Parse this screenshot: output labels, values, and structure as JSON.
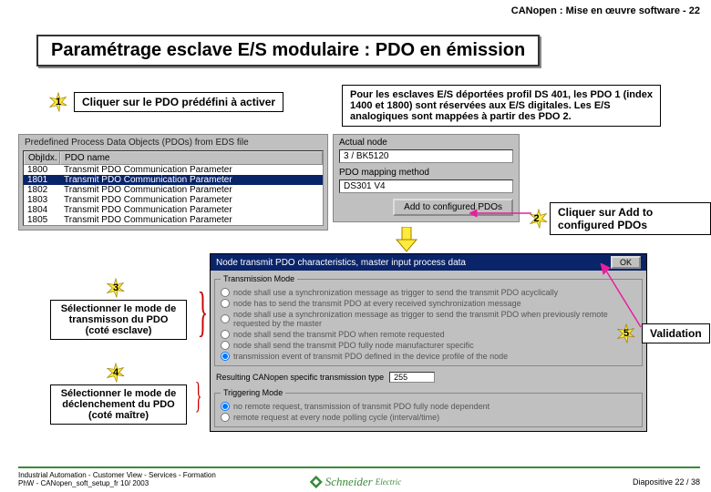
{
  "header": {
    "doc_title": "CANopen : Mise en œuvre software",
    "page_num": "22"
  },
  "title": "Paramétrage esclave E/S modulaire : PDO en émission",
  "steps": {
    "s1": {
      "num": "1",
      "text": "Cliquer sur le PDO prédéfini à activer"
    },
    "s2": {
      "num": "2",
      "text": "Cliquer sur Add to configured PDOs"
    },
    "s3": {
      "num": "3",
      "text": "Sélectionner le mode de transmisson du PDO (coté esclave)"
    },
    "s4": {
      "num": "4",
      "text": "Sélectionner le mode de déclenchement du PDO (coté maître)"
    },
    "s5": {
      "num": "5",
      "text": "Validation"
    }
  },
  "info": "Pour les esclaves E/S déportées profil DS 401, les PDO 1 (index 1400 et 1800) sont réservées aux E/S digitales. Les E/S analogiques sont mappées à partir des PDO 2.",
  "pdo_panel": {
    "title": "Predefined Process Data Objects (PDOs) from EDS file",
    "col_idx": "ObjIdx.",
    "col_name": "PDO name",
    "rows": [
      {
        "idx": "1800",
        "name": "Transmit PDO Communication Parameter"
      },
      {
        "idx": "1801",
        "name": "Transmit PDO Communication Parameter"
      },
      {
        "idx": "1802",
        "name": "Transmit PDO Communication Parameter"
      },
      {
        "idx": "1803",
        "name": "Transmit PDO Communication Parameter"
      },
      {
        "idx": "1804",
        "name": "Transmit PDO Communication Parameter"
      },
      {
        "idx": "1805",
        "name": "Transmit PDO Communication Parameter"
      }
    ]
  },
  "actual": {
    "lbl_node": "Actual node",
    "val_node": "3 / BK5120",
    "lbl_map": "PDO mapping method",
    "val_map": "DS301 V4",
    "btn_add": "Add to configured PDOs"
  },
  "dialog": {
    "title": "Node transmit PDO characteristics, master input process data",
    "ok": "OK",
    "trans_legend": "Transmission Mode",
    "trans": [
      "node shall use a synchronization message as trigger to send the transmit PDO acyclically",
      "node has to send the transmit PDO at every          received synchronization message",
      "node shall use a synchronization message as trigger to send the transmit PDO when previously remote requested by the master",
      "node shall send the transmit PDO when remote requested",
      "node shall send the transmit PDO fully node manufacturer specific",
      "transmission event of transmit PDO defined in the device profile of the node"
    ],
    "result_lbl": "Resulting CANopen specific transmission type",
    "result_val": "255",
    "trig_legend": "Triggering Mode",
    "trig": [
      "no remote request, transmission of transmit PDO fully node dependent",
      "remote request at every          node polling cycle (interval/time)"
    ]
  },
  "footer": {
    "line1": "Industrial Automation - Customer View - Services - Formation",
    "line2": "PhW - CANopen_soft_setup_fr  10/ 2003",
    "logo": "Schneider Electric",
    "slide": "Diapositive 22 / 38"
  }
}
